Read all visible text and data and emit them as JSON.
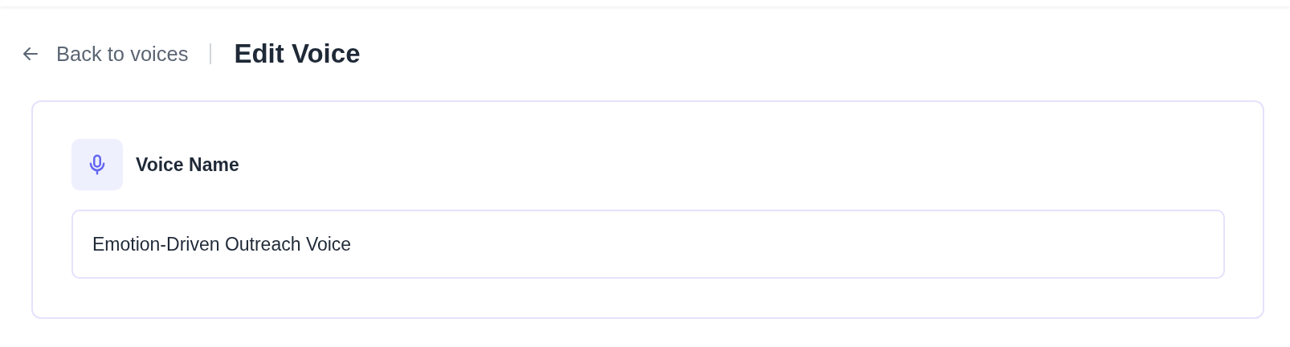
{
  "header": {
    "back_link": "Back to voices",
    "title": "Edit Voice"
  },
  "card": {
    "label": "Voice Name",
    "value": "Emotion-Driven Outreach Voice"
  }
}
